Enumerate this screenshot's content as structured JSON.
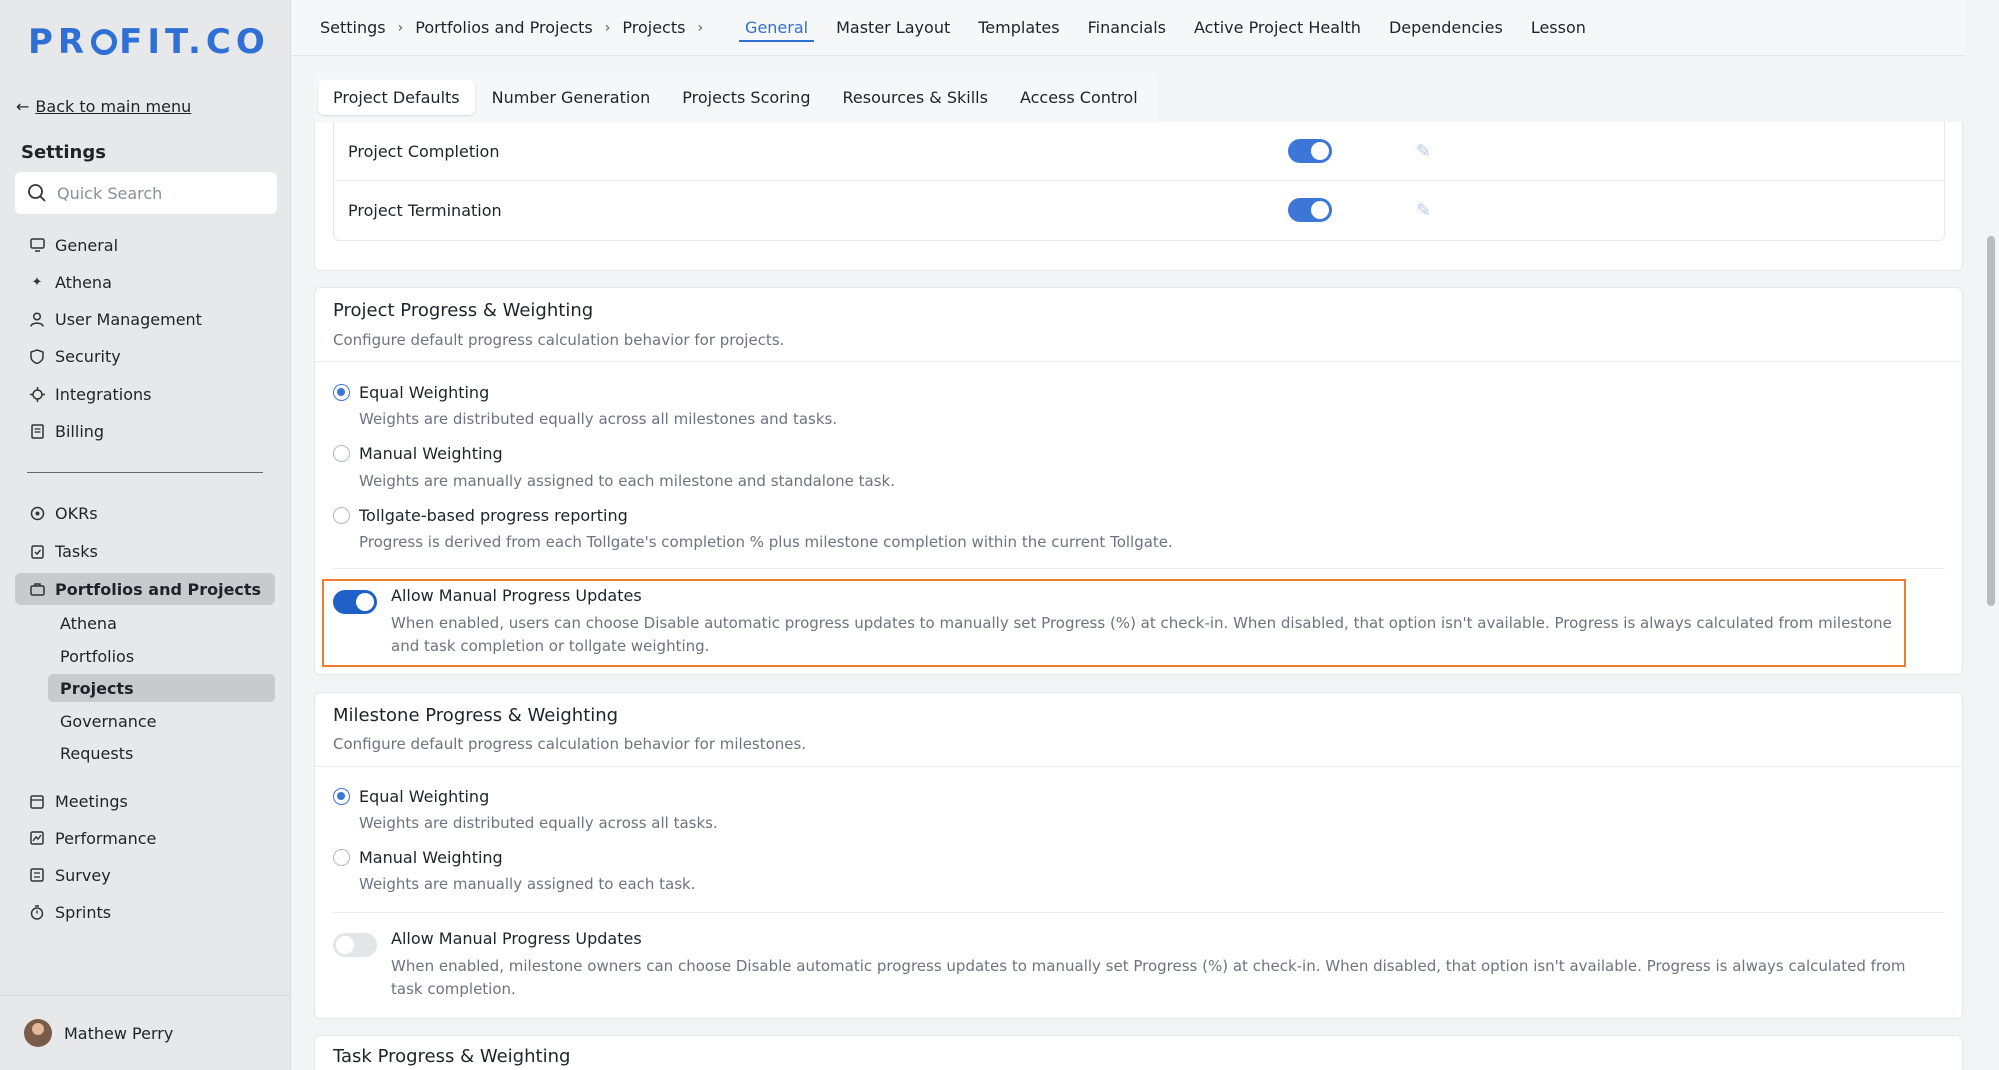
{
  "brand": {
    "logo_prefix": "PR",
    "logo_suffix": "FIT.CO"
  },
  "sidebar": {
    "back_label": "Back to main menu",
    "title": "Settings",
    "search_placeholder": "Quick Search",
    "items_top": [
      {
        "label": "General",
        "icon": "monitor-icon"
      },
      {
        "label": "Athena",
        "icon": "sparkle-icon"
      },
      {
        "label": "User Management",
        "icon": "user-icon"
      },
      {
        "label": "Security",
        "icon": "shield-icon"
      },
      {
        "label": "Integrations",
        "icon": "integrations-icon"
      },
      {
        "label": "Billing",
        "icon": "receipt-icon"
      }
    ],
    "items_bottom": [
      {
        "label": "OKRs",
        "icon": "target-icon"
      },
      {
        "label": "Tasks",
        "icon": "clipboard-check-icon"
      },
      {
        "label": "Portfolios and Projects",
        "icon": "briefcase-icon"
      }
    ],
    "sub_items": [
      "Athena",
      "Portfolios",
      "Projects",
      "Governance",
      "Requests"
    ],
    "items_after": [
      {
        "label": "Meetings",
        "icon": "calendar-icon"
      },
      {
        "label": "Performance",
        "icon": "chart-line-icon"
      },
      {
        "label": "Survey",
        "icon": "survey-icon"
      },
      {
        "label": "Sprints",
        "icon": "stopwatch-icon"
      }
    ],
    "user_name": "Mathew Perry"
  },
  "breadcrumb": [
    "Settings",
    "Portfolios and Projects",
    "Projects"
  ],
  "top_tabs": [
    "General",
    "Master Layout",
    "Templates",
    "Financials",
    "Active Project Health",
    "Dependencies",
    "Lesson"
  ],
  "sub_tabs": [
    "Project Defaults",
    "Number Generation",
    "Projects Scoring",
    "Resources & Skills",
    "Access Control"
  ],
  "status_rows": [
    {
      "label": "Project Completion",
      "enabled": true
    },
    {
      "label": "Project Termination",
      "enabled": true
    }
  ],
  "project_progress": {
    "title": "Project Progress & Weighting",
    "desc": "Configure default progress calculation behavior for projects.",
    "options": [
      {
        "label": "Equal Weighting",
        "desc": "Weights are distributed equally across all milestones and tasks.",
        "selected": true
      },
      {
        "label": "Manual Weighting",
        "desc": "Weights are manually assigned to each milestone and standalone task.",
        "selected": false
      },
      {
        "label": "Tollgate-based progress reporting",
        "desc": "Progress is derived from each Tollgate's completion % plus milestone completion within the current Tollgate.",
        "selected": false
      }
    ],
    "manual_updates": {
      "title": "Allow Manual Progress Updates",
      "desc": "When enabled, users can choose Disable automatic progress updates to manually set Progress (%) at check-in. When disabled, that option isn't available. Progress is always calculated from milestone and task completion or tollgate weighting.",
      "enabled": true
    }
  },
  "milestone_progress": {
    "title": "Milestone Progress & Weighting",
    "desc": "Configure default progress calculation behavior for milestones.",
    "options": [
      {
        "label": "Equal Weighting",
        "desc": "Weights are distributed equally across all tasks.",
        "selected": true
      },
      {
        "label": "Manual Weighting",
        "desc": "Weights are manually assigned to each task.",
        "selected": false
      }
    ],
    "manual_updates": {
      "title": "Allow Manual Progress Updates",
      "desc": "When enabled, milestone owners can choose Disable automatic progress updates to manually set Progress (%) at check-in. When disabled, that option isn't available. Progress is always calculated from task completion.",
      "enabled": false
    }
  },
  "task_progress": {
    "title": "Task Progress & Weighting"
  },
  "colors": {
    "accent": "#2f6fd6",
    "highlight": "#ed7d31"
  }
}
